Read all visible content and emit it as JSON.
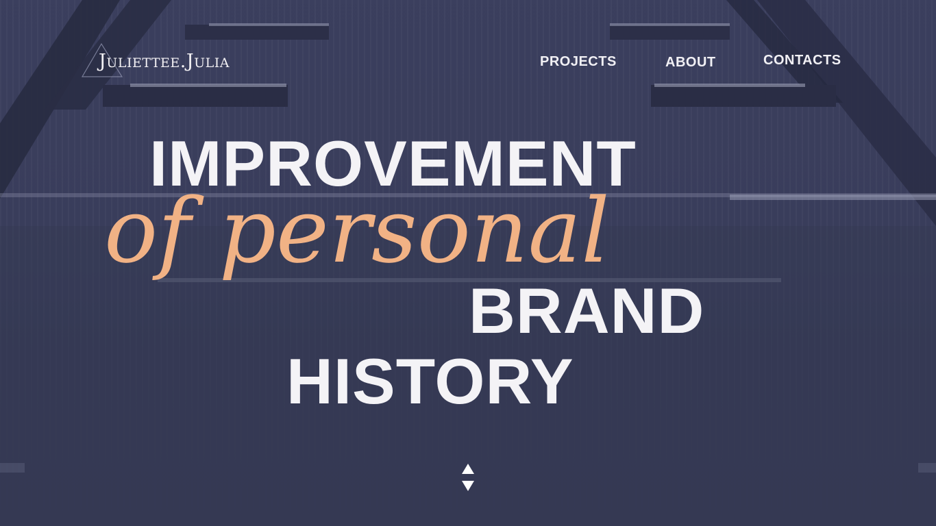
{
  "header": {
    "logo_text": "Juliettee.Julia",
    "nav": {
      "projects": "PROJECTS",
      "about": "ABOUT",
      "contacts": "CONTACTS"
    }
  },
  "hero": {
    "line1": "IMPROVEMENT",
    "line2": "of personal",
    "line3": "BRAND",
    "line4": "HISTORY"
  },
  "scroll_control": {
    "icon_up": "triangle-up-icon",
    "icon_down": "triangle-down-icon"
  },
  "colors": {
    "background": "#353851",
    "text": "#f4f3f6",
    "accent": "#f1b285"
  }
}
